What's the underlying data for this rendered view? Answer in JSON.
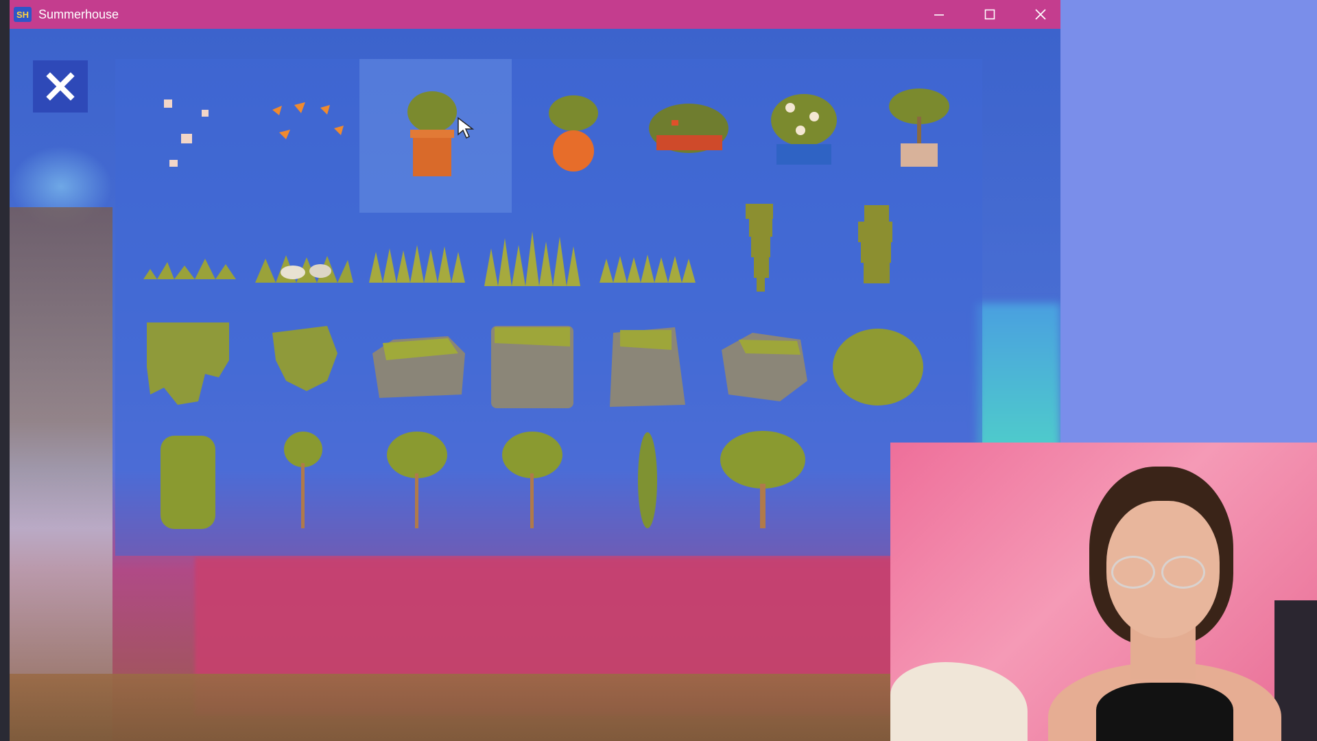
{
  "window": {
    "app_icon_text": "SH",
    "title": "Summerhouse",
    "controls": {
      "minimize_icon": "minimize-icon",
      "maximize_icon": "maximize-icon",
      "close_icon": "close-icon"
    },
    "accent": "#c43d8e"
  },
  "panel": {
    "close_icon": "close-x-icon",
    "selected_item": "potted-round-tree",
    "rows": [
      [
        "falling-blossoms",
        "orange-leaves",
        "potted-round-tree",
        "orange-vase-plant",
        "flower-box-bush",
        "blue-pot-flowers",
        "potted-small-tree"
      ],
      [
        "grass-tuft-small",
        "grass-with-stones",
        "grass-tall",
        "grass-taller",
        "grass-short-wide",
        "hanging-vine-long",
        "hanging-vine-short"
      ],
      [
        "ivy-patch-large",
        "ivy-patch-small",
        "mossy-rock-flat",
        "mossy-rock-face",
        "mossy-rock-tall",
        "mossy-rock-round",
        "round-bush"
      ],
      [
        "tall-hedge",
        "thin-tree",
        "small-tree",
        "small-tree-2",
        "cypress-tree",
        "wide-tree"
      ]
    ]
  },
  "webcam": {
    "label": "webcam-overlay"
  }
}
